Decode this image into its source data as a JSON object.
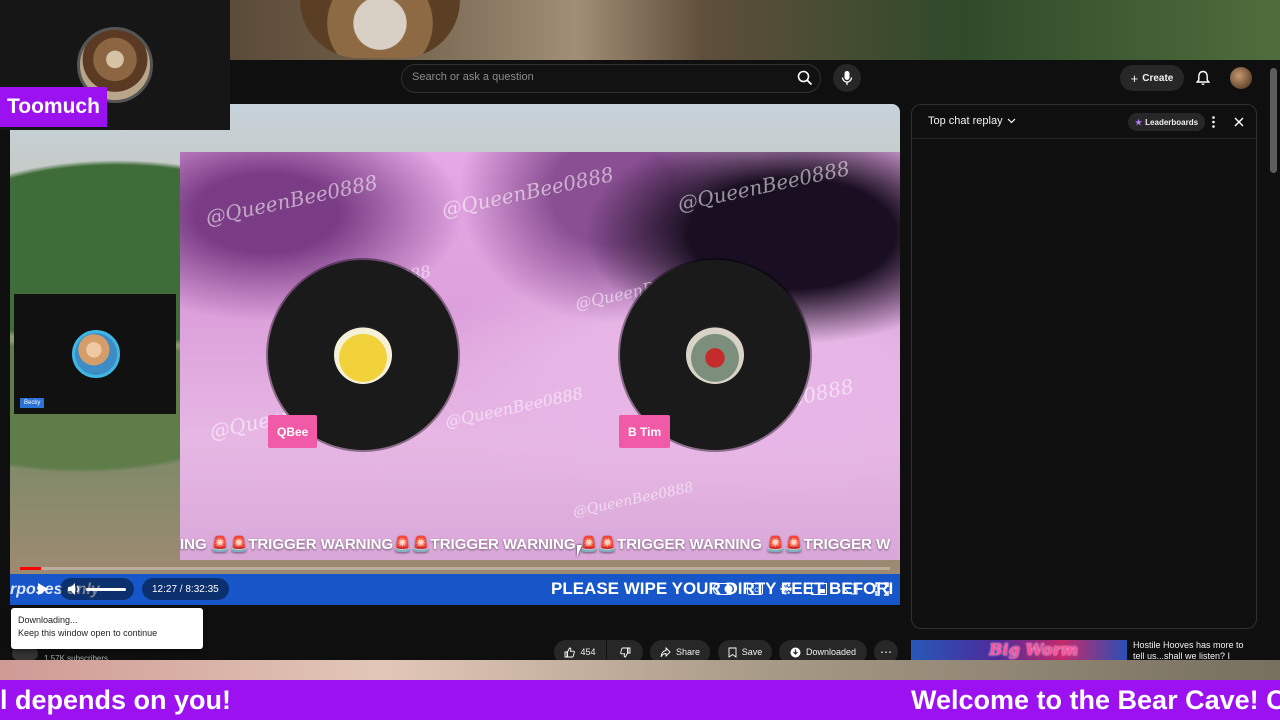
{
  "overlay": {
    "streamer_name": "Toomuch"
  },
  "search": {
    "placeholder": "Search or ask a question"
  },
  "header": {
    "create_label": "Create"
  },
  "player": {
    "pip_tag": "Becky",
    "guest_left_name": "QBee",
    "guest_right_name": "B Tim",
    "watermark": "@QueenBee0888",
    "ticker_text": "ING 🚨🚨TRIGGER WARNING🚨🚨TRIGGER WARNING 🚨🚨TRIGGER WARNING 🚨🚨TRIGGER W",
    "lower_ticker_left": "rposes only",
    "lower_ticker_right": "PLEASE WIPE YOUR DIRTY FEET BEFORI",
    "time_display": "12:27 / 8:32:35",
    "progress_fraction": 0.024
  },
  "actions": {
    "like_count": "454",
    "share_label": "Share",
    "save_label": "Save",
    "download_label": "Downloaded",
    "subscribers": "1.57K subscribers"
  },
  "chat": {
    "title": "Top chat replay",
    "leaderboards_label": "Leaderboards"
  },
  "recommendation": {
    "thumb_text": "Big Worm",
    "title": "Hostile Hooves has more to tell us...shall we listen? I"
  },
  "toast": {
    "line1": "Downloading...",
    "line2": "Keep this window open to continue"
  },
  "banner": {
    "left_text": "l depends on you!",
    "right_text": "Welcome to the Bear Cave! C"
  },
  "colors": {
    "overlay_purple": "#9b11f0",
    "pink_tag": "#f05aa6",
    "ticker_blue": "#1656c8",
    "progress_red": "#ff0000"
  }
}
